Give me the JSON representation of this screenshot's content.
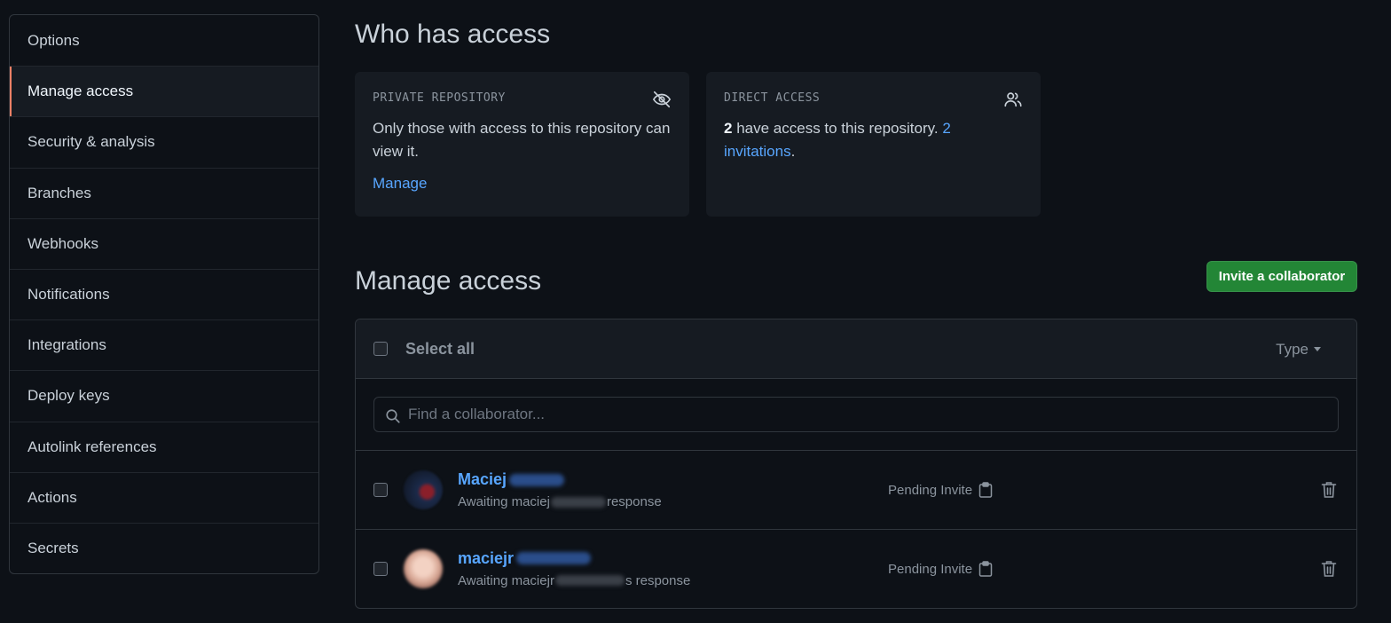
{
  "sidebar": {
    "items": [
      {
        "label": "Options"
      },
      {
        "label": "Manage access"
      },
      {
        "label": "Security & analysis"
      },
      {
        "label": "Branches"
      },
      {
        "label": "Webhooks"
      },
      {
        "label": "Notifications"
      },
      {
        "label": "Integrations"
      },
      {
        "label": "Deploy keys"
      },
      {
        "label": "Autolink references"
      },
      {
        "label": "Actions"
      },
      {
        "label": "Secrets"
      }
    ],
    "selected": "Manage access"
  },
  "who_has_access": {
    "title": "Who has access",
    "private_card": {
      "label": "PRIVATE REPOSITORY",
      "icon": "eye-closed-icon",
      "text": "Only those with access to this repository can view it.",
      "link": "Manage"
    },
    "direct_card": {
      "label": "DIRECT ACCESS",
      "icon": "people-icon",
      "count": "2",
      "text": " have access to this repository. ",
      "invite_link": "2 invitations",
      "end": "."
    }
  },
  "manage_access": {
    "title": "Manage access",
    "invite_button": "Invite a collaborator",
    "select_all": "Select all",
    "type_filter": "Type",
    "search": {
      "placeholder": "Find a collaborator..."
    },
    "collaborators": [
      {
        "name": "Maciej",
        "sub_prefix": "Awaiting maciej",
        "sub_suffix": " response",
        "status": "Pending Invite"
      },
      {
        "name": "maciejr",
        "sub_prefix": "Awaiting maciejr",
        "sub_suffix": "s response",
        "status": "Pending Invite"
      }
    ]
  },
  "colors": {
    "background": "#0d1117",
    "card": "#161b22",
    "accent_link": "#58a6ff",
    "selected_marker": "#f78166",
    "invite_button": "#238636"
  }
}
